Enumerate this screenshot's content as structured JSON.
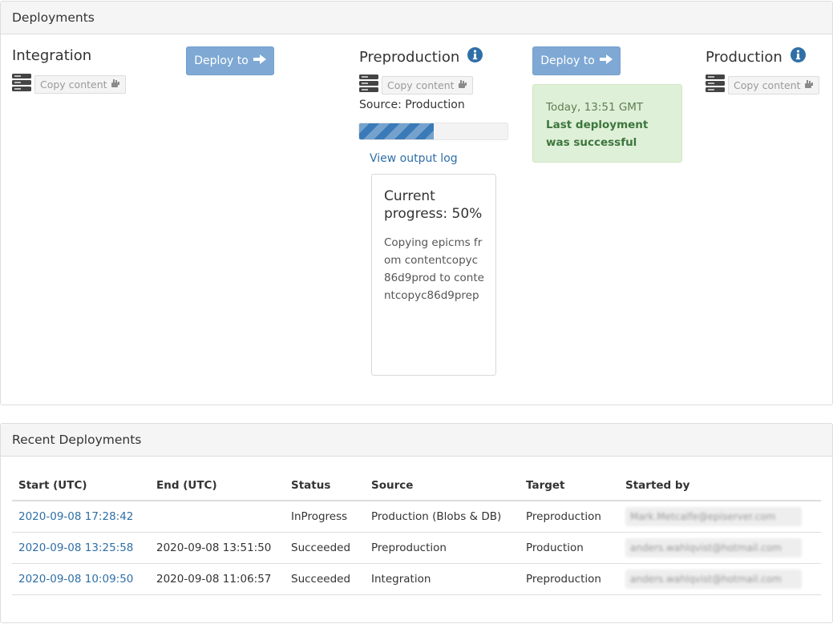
{
  "deployments_panel": {
    "title": "Deployments",
    "environments": [
      {
        "name": "Integration",
        "copy_label": "Copy content",
        "has_info": false
      },
      {
        "name": "Preproduction",
        "copy_label": "Copy content",
        "has_info": true,
        "source_text": "Source: Production",
        "progress_fraction": 0.5,
        "view_log_label": "View output log",
        "progress_heading": "Current progress: 50%",
        "progress_detail": "Copying epicms from contentcopyc86d9prod to contentcopyc86d9prep"
      },
      {
        "name": "Production",
        "copy_label": "Copy content",
        "has_info": true
      }
    ],
    "deploy_buttons": [
      {
        "label": "Deploy to"
      },
      {
        "label": "Deploy to"
      }
    ],
    "last_deployment": {
      "time": "Today, 13:51 GMT",
      "message": "Last deployment was successful"
    }
  },
  "recent_panel": {
    "title": "Recent Deployments",
    "columns": [
      "Start (UTC)",
      "End (UTC)",
      "Status",
      "Source",
      "Target",
      "Started by"
    ],
    "rows": [
      {
        "start": "2020-09-08 17:28:42",
        "end": "",
        "status": "InProgress",
        "source": "Production (Blobs & DB)",
        "target": "Preproduction",
        "started_by": "Mark.Metcalfe@episerver.com"
      },
      {
        "start": "2020-09-08 13:25:58",
        "end": "2020-09-08 13:51:50",
        "status": "Succeeded",
        "source": "Preproduction",
        "target": "Production",
        "started_by": "anders.wahlqvist@hotmail.com"
      },
      {
        "start": "2020-09-08 10:09:50",
        "end": "2020-09-08 11:06:57",
        "status": "Succeeded",
        "source": "Integration",
        "target": "Preproduction",
        "started_by": "anders.wahlqvist@hotmail.com"
      }
    ]
  },
  "colors": {
    "accent": "#3a7ab8",
    "deploy_button": "#7fa9d4",
    "success_bg": "#dff0d8",
    "success_text": "#3c763d",
    "link": "#2f6fa7"
  },
  "icons": {
    "server": "server-stack-icon",
    "copy": "copy-hand-icon",
    "info": "info-circle-icon",
    "arrow": "arrow-right-icon"
  }
}
